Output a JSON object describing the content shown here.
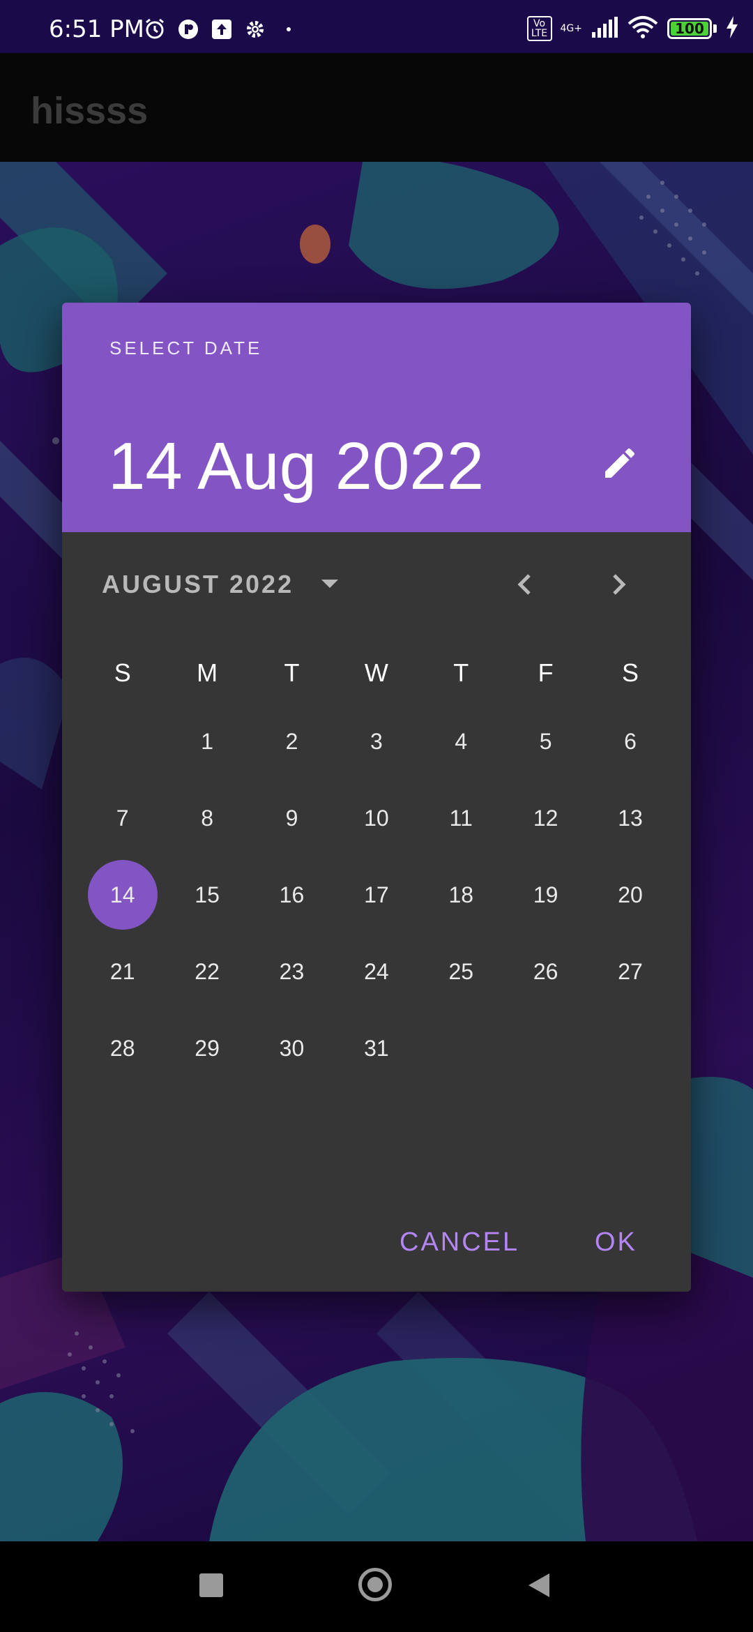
{
  "status_bar": {
    "time": "6:51 PM",
    "volte": "Vo LTE",
    "network": "4G+",
    "battery": "100"
  },
  "app_bar": {
    "title": "hissss"
  },
  "dialog": {
    "header_label": "SELECT DATE",
    "selected_date": "14 Aug 2022",
    "month_year": "AUGUST 2022",
    "weekdays": [
      "S",
      "M",
      "T",
      "W",
      "T",
      "F",
      "S"
    ],
    "days": [
      "",
      "1",
      "2",
      "3",
      "4",
      "5",
      "6",
      "7",
      "8",
      "9",
      "10",
      "11",
      "12",
      "13",
      "14",
      "15",
      "16",
      "17",
      "18",
      "19",
      "20",
      "21",
      "22",
      "23",
      "24",
      "25",
      "26",
      "27",
      "28",
      "29",
      "30",
      "31"
    ],
    "selected_day": "14",
    "cancel_label": "CANCEL",
    "ok_label": "OK",
    "accent_color": "#8355c4",
    "button_color": "#b485f5"
  }
}
